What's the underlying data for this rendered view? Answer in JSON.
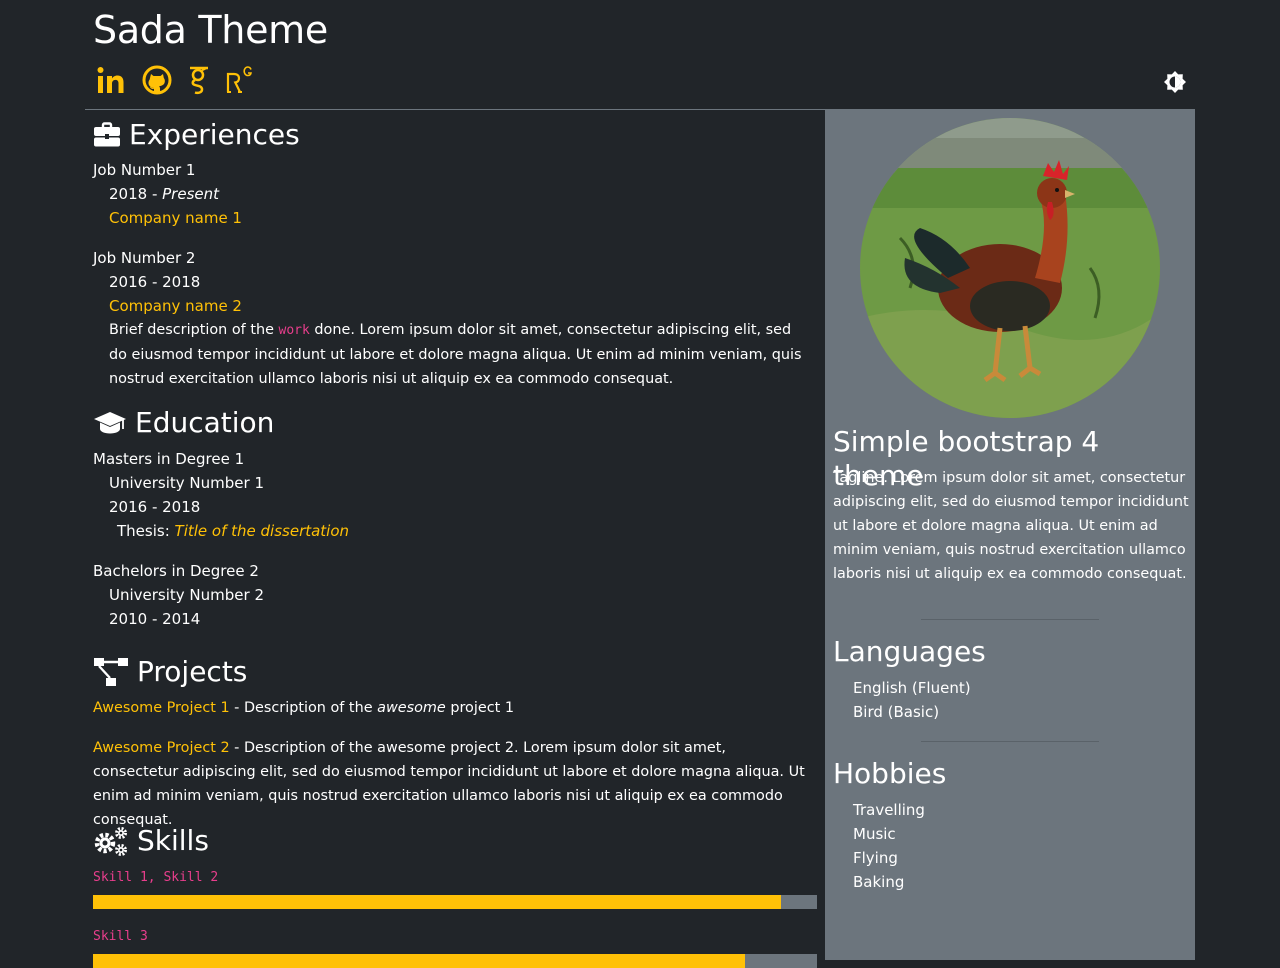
{
  "site": {
    "title": "Sada Theme"
  },
  "social": [
    {
      "name": "LinkedIn",
      "icon": "linkedin-icon"
    },
    {
      "name": "GitHub",
      "icon": "github-icon"
    },
    {
      "name": "Google Scholar",
      "icon": "google-scholar-icon"
    },
    {
      "name": "ResearchGate",
      "icon": "researchgate-icon"
    }
  ],
  "theme_toggle": {
    "icon": "brightness-icon"
  },
  "colors": {
    "background": "#212529",
    "accent": "#ffc107",
    "sidebar": "#6c757d",
    "code": "#e83e8c"
  },
  "experiences": {
    "title": "Experiences",
    "jobs": [
      {
        "role": "Job Number 1",
        "dates_prefix": "2018 - ",
        "dates_italic": "Present",
        "company": "Company name 1"
      },
      {
        "role": "Job Number 2",
        "dates": "2016 - 2018",
        "company": "Company name 2",
        "desc_before": "Brief description of the ",
        "desc_code": "work",
        "desc_after": " done. Lorem ipsum dolor sit amet, consectetur adipiscing elit, sed do eiusmod tempor incididunt ut labore et dolore magna aliqua. Ut enim ad minim veniam, quis nostrud exercitation ullamco laboris nisi ut aliquip ex ea commodo consequat."
      }
    ]
  },
  "education": {
    "title": "Education",
    "degrees": [
      {
        "degree": "Masters in Degree 1",
        "university": "University Number 1",
        "dates": "2016 - 2018",
        "thesis_label": "Thesis: ",
        "thesis_title": "Title of the dissertation"
      },
      {
        "degree": "Bachelors in Degree 2",
        "university": "University Number 2",
        "dates": "2010 - 2014"
      }
    ]
  },
  "projects": {
    "title": "Projects",
    "items": [
      {
        "name": "Awesome Project 1",
        "desc_before": " - Description of the ",
        "desc_em": "awesome",
        "desc_after": " project 1"
      },
      {
        "name": "Awesome Project 2",
        "desc": " - Description of the awesome project 2. Lorem ipsum dolor sit amet, consectetur adipiscing elit, sed do eiusmod tempor incididunt ut labore et dolore magna aliqua. Ut enim ad minim veniam, quis nostrud exercitation ullamco laboris nisi ut aliquip ex ea commodo consequat."
      }
    ]
  },
  "skills": {
    "title": "Skills",
    "items": [
      {
        "label": "Skill 1, Skill 2",
        "level": 0.95
      },
      {
        "label": "Skill 3",
        "level": 0.9
      }
    ]
  },
  "profile": {
    "avatar": "rooster-photo",
    "title": "Simple bootstrap 4 theme",
    "tagline": "Tagline. Lorem ipsum dolor sit amet, consectetur adipiscing elit, sed do eiusmod tempor incididunt ut labore et dolore magna aliqua. Ut enim ad minim veniam, quis nostrud exercitation ullamco laboris nisi ut aliquip ex ea commodo consequat."
  },
  "languages": {
    "title": "Languages",
    "items": [
      "English (Fluent)",
      "Bird (Basic)"
    ]
  },
  "hobbies": {
    "title": "Hobbies",
    "items": [
      "Travelling",
      "Music",
      "Flying",
      "Baking"
    ]
  }
}
